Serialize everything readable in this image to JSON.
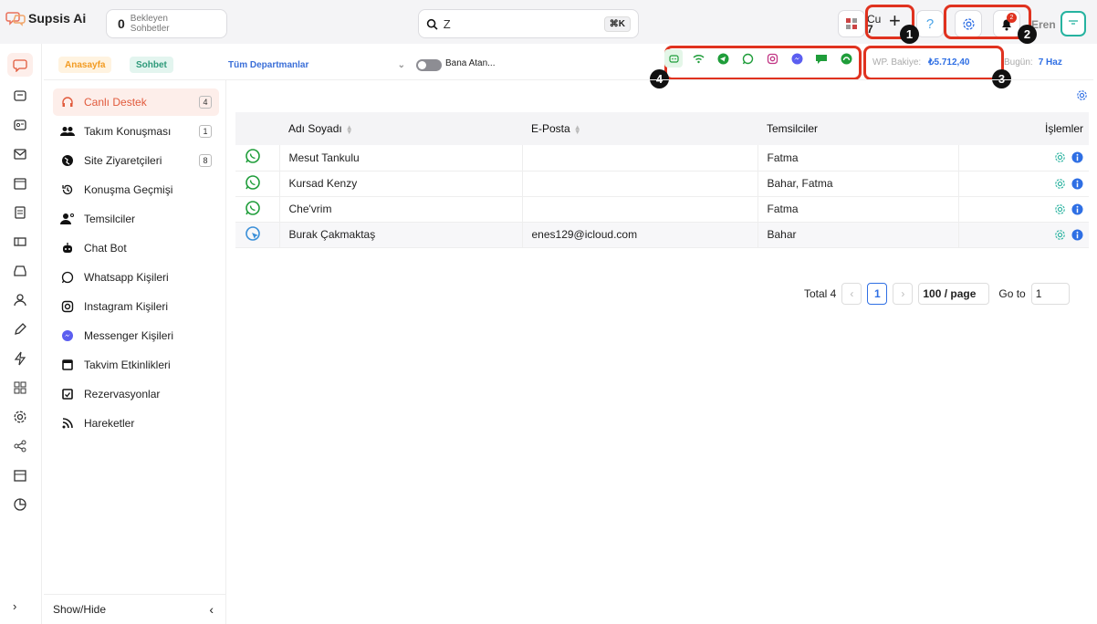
{
  "app": {
    "name": "Supsis Ai"
  },
  "pending": {
    "count": "0",
    "label_top": "Bekleyen",
    "label_bottom": "Sohbetler"
  },
  "search": {
    "value": "Z",
    "shortcut": "⌘K"
  },
  "toolbar": {
    "cu_label": "Cu",
    "cu_count": "7",
    "help_label": "?",
    "notifications_count": "2",
    "user_name": "Eren"
  },
  "markers": [
    "1",
    "2",
    "3",
    "4"
  ],
  "breadcrumb": {
    "home": "Anasayfa",
    "chat": "Sohbet",
    "department": "Tüm Departmanlar",
    "assigned_toggle_label": "Bana Atan..."
  },
  "balance": {
    "label": "WP. Bakiye:",
    "value": "₺5.712,40"
  },
  "today": {
    "label": "Bugün:",
    "value": "7 Haz"
  },
  "channels": [
    "chatbot",
    "wifi",
    "telegram",
    "whatsapp",
    "instagram",
    "messenger",
    "sms",
    "other"
  ],
  "rail": [
    "chat",
    "support",
    "contacts",
    "mail",
    "calendar",
    "documents",
    "tickets",
    "inbox",
    "users",
    "edit",
    "automation",
    "apps",
    "settings",
    "share",
    "store",
    "reports"
  ],
  "sidebar": {
    "items": [
      {
        "label": "Canlı Destek",
        "badge": "4",
        "icon": "headset-icon"
      },
      {
        "label": "Takım Konuşması",
        "badge": "1",
        "icon": "team-icon"
      },
      {
        "label": "Site Ziyaretçileri",
        "badge": "8",
        "icon": "globe-icon"
      },
      {
        "label": "Konuşma Geçmişi",
        "badge": "",
        "icon": "history-icon"
      },
      {
        "label": "Temsilciler",
        "badge": "",
        "icon": "agents-icon"
      },
      {
        "label": "Chat Bot",
        "badge": "",
        "icon": "bot-icon"
      },
      {
        "label": "Whatsapp Kişileri",
        "badge": "",
        "icon": "whatsapp-icon"
      },
      {
        "label": "Instagram Kişileri",
        "badge": "",
        "icon": "instagram-icon"
      },
      {
        "label": "Messenger Kişileri",
        "badge": "",
        "icon": "messenger-icon"
      },
      {
        "label": "Takvim Etkinlikleri",
        "badge": "",
        "icon": "calendar-icon"
      },
      {
        "label": "Rezervasyonlar",
        "badge": "",
        "icon": "reservation-icon"
      },
      {
        "label": "Hareketler",
        "badge": "",
        "icon": "feed-icon"
      }
    ],
    "show_hide": "Show/Hide"
  },
  "table": {
    "headers": {
      "name": "Adı Soyadı",
      "email": "E-Posta",
      "agents": "Temsilciler",
      "actions": "İşlemler"
    },
    "rows": [
      {
        "channel": "whatsapp",
        "name": "Mesut Tankulu",
        "email": "",
        "agents": "Fatma"
      },
      {
        "channel": "whatsapp",
        "name": "Kursad Kenzy",
        "email": "",
        "agents": "Bahar, Fatma"
      },
      {
        "channel": "whatsapp",
        "name": "Che'vrim",
        "email": "",
        "agents": "Fatma"
      },
      {
        "channel": "web",
        "name": "Burak Çakmaktaş",
        "email": "enes129@icloud.com",
        "agents": "Bahar"
      }
    ]
  },
  "pagination": {
    "total_label": "Total 4",
    "current_page": "1",
    "page_size": "100 / page",
    "goto_label": "Go to",
    "goto_value": "1"
  },
  "colors": {
    "accent": "#e15a3c",
    "blue": "#2f6fe4",
    "green": "#1f9d3a",
    "highlight": "#e0321f"
  }
}
